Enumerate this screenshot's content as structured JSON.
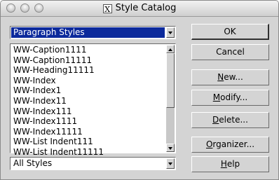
{
  "window": {
    "title": "Style Catalog",
    "app_icon": "x11-icon"
  },
  "style_type_select": {
    "value": "Paragraph Styles"
  },
  "styles_list": {
    "items": [
      "WW-Caption1111",
      "WW-Caption11111",
      "WW-Heading11111",
      "WW-Index",
      "WW-Index1",
      "WW-Index11",
      "WW-Index111",
      "WW-Index1111",
      "WW-Index11111",
      "WW-List Indent111",
      "WW-List Indent11111"
    ]
  },
  "filter_select": {
    "value": "All Styles"
  },
  "buttons": {
    "ok": {
      "label": "OK"
    },
    "cancel": {
      "label": "Cancel"
    },
    "new": {
      "mnemonic": "N",
      "rest": "ew..."
    },
    "modify": {
      "mnemonic": "M",
      "rest": "odify..."
    },
    "delete": {
      "mnemonic": "D",
      "rest": "elete..."
    },
    "organizer": {
      "mnemonic": "O",
      "rest": "rganizer..."
    },
    "help": {
      "mnemonic": "H",
      "rest": "elp"
    }
  }
}
